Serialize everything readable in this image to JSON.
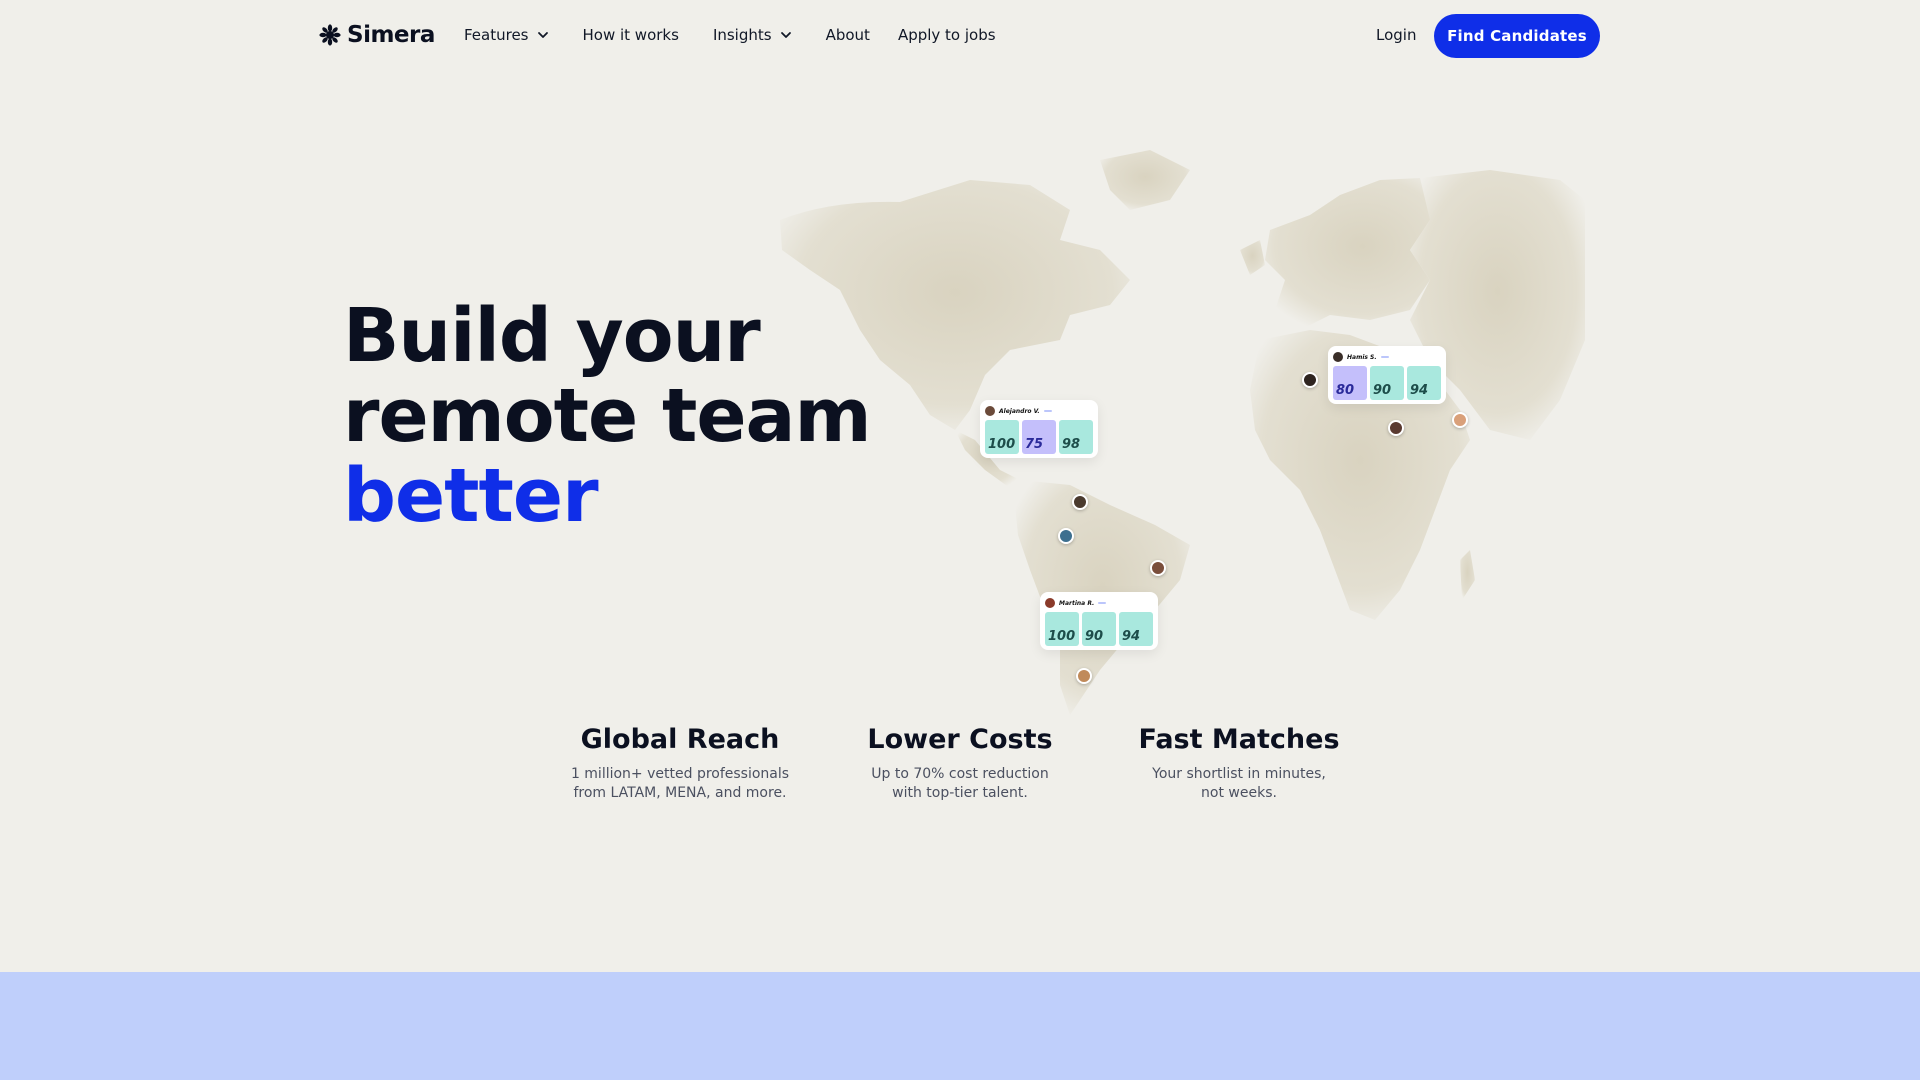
{
  "nav": {
    "brand": "Simera",
    "links": [
      {
        "label": "Features",
        "has_dropdown": true
      },
      {
        "label": "How it works",
        "has_dropdown": false
      },
      {
        "label": "Insights",
        "has_dropdown": true
      },
      {
        "label": "About",
        "has_dropdown": false
      },
      {
        "label": "Apply to jobs",
        "has_dropdown": false
      }
    ],
    "login_label": "Login",
    "cta_label": "Find Candidates"
  },
  "hero": {
    "line1": "Build your",
    "line2": "remote team",
    "accent": "better"
  },
  "map": {
    "cards": [
      {
        "name": "Alejandro V.",
        "scores": [
          100,
          75,
          98
        ]
      },
      {
        "name": "Hamis S.",
        "scores": [
          80,
          90,
          94
        ]
      },
      {
        "name": "Martina R.",
        "scores": [
          100,
          90,
          94
        ]
      }
    ]
  },
  "features": [
    {
      "title": "Global Reach",
      "desc": "1 million+ vetted professionals\nfrom LATAM, MENA, and more."
    },
    {
      "title": "Lower Costs",
      "desc": "Up to 70% cost reduction\nwith top-tier talent."
    },
    {
      "title": "Fast Matches",
      "desc": "Your shortlist in minutes,\nnot weeks."
    }
  ],
  "colors": {
    "accent": "#0f2ee8",
    "background": "#f0efea",
    "band": "#bfcffb"
  }
}
